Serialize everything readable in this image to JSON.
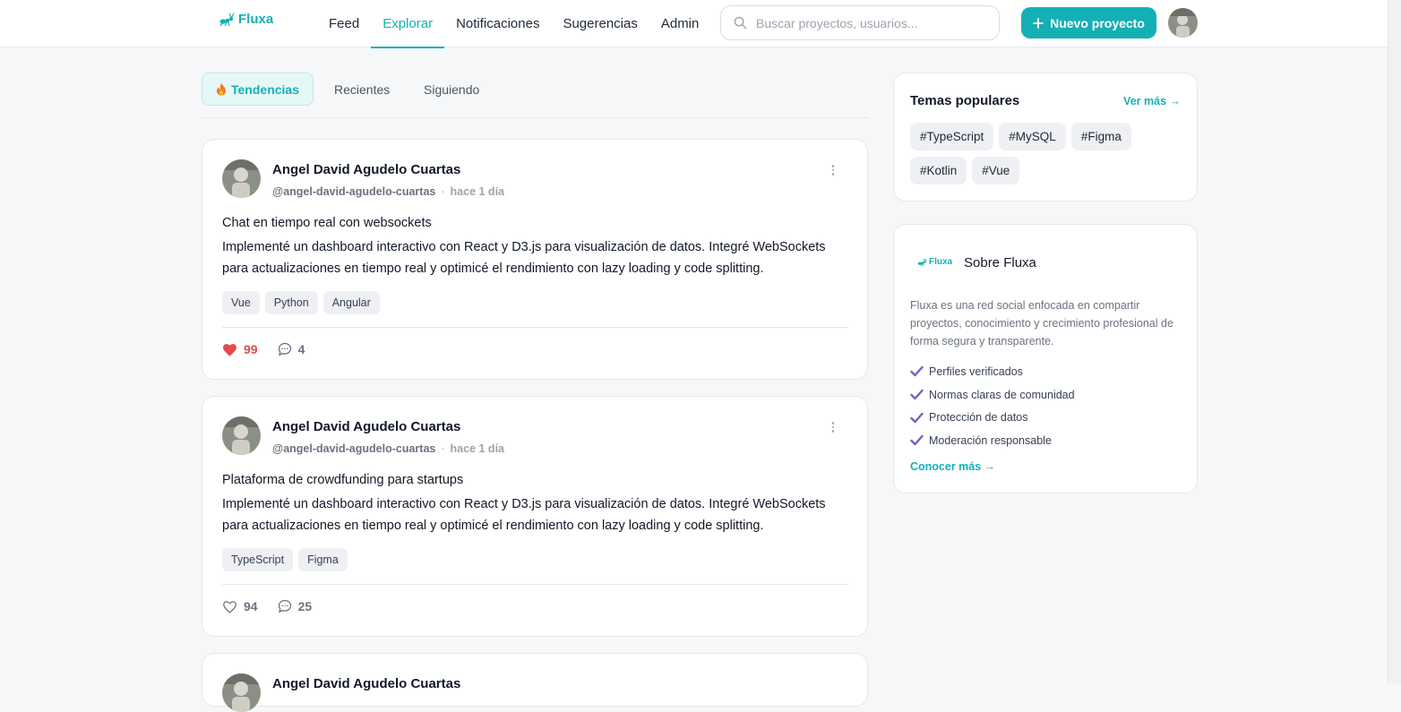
{
  "brand": {
    "name": "Fluxa",
    "accent": "#14b0b5",
    "like_color": "#e5484d",
    "check_color": "#7c5cc4"
  },
  "nav": [
    {
      "label": "Feed",
      "active": false
    },
    {
      "label": "Explorar",
      "active": true
    },
    {
      "label": "Notificaciones",
      "active": false
    },
    {
      "label": "Sugerencias",
      "active": false
    },
    {
      "label": "Admin",
      "active": false
    }
  ],
  "search": {
    "placeholder": "Buscar proyectos, usuarios...",
    "icon": "search-icon"
  },
  "new_project_button": {
    "label": "Nuevo proyecto",
    "icon": "plus-icon"
  },
  "tabs": [
    {
      "label": "Tendencias",
      "icon": "fire-icon",
      "active": true
    },
    {
      "label": "Recientes",
      "active": false
    },
    {
      "label": "Siguiendo",
      "active": false
    }
  ],
  "posts": [
    {
      "author": "Angel David Agudelo Cuartas",
      "handle": "@angel-david-agudelo-cuartas",
      "time": "hace 1 día",
      "title": "Chat en tiempo real con websockets",
      "body": "Implementé un dashboard interactivo con React y D3.js para visualización de datos. Integré WebSockets para actualizaciones en tiempo real y optimicé el rendimiento con lazy loading y code splitting.",
      "tags": [
        "Vue",
        "Python",
        "Angular"
      ],
      "likes": "99",
      "liked": true,
      "comments": "4"
    },
    {
      "author": "Angel David Agudelo Cuartas",
      "handle": "@angel-david-agudelo-cuartas",
      "time": "hace 1 día",
      "title": "Plataforma de crowdfunding para startups",
      "body": "Implementé un dashboard interactivo con React y D3.js para visualización de datos. Integré WebSockets para actualizaciones en tiempo real y optimicé el rendimiento con lazy loading y code splitting.",
      "tags": [
        "TypeScript",
        "Figma"
      ],
      "likes": "94",
      "liked": false,
      "comments": "25"
    },
    {
      "author": "Angel David Agudelo Cuartas"
    }
  ],
  "popular_topics": {
    "title": "Temas populares",
    "see_more": "Ver más →",
    "topics": [
      "#TypeScript",
      "#MySQL",
      "#Figma",
      "#Kotlin",
      "#Vue"
    ]
  },
  "about": {
    "title": "Sobre Fluxa",
    "logo_text": "Fluxa",
    "description": "Fluxa es una red social enfocada en compartir proyectos, conocimiento y crecimiento profesional de forma segura y transparente.",
    "features": [
      "Perfiles verificados",
      "Normas claras de comunidad",
      "Protección de datos",
      "Moderación responsable"
    ],
    "learn_more": "Conocer más →"
  }
}
